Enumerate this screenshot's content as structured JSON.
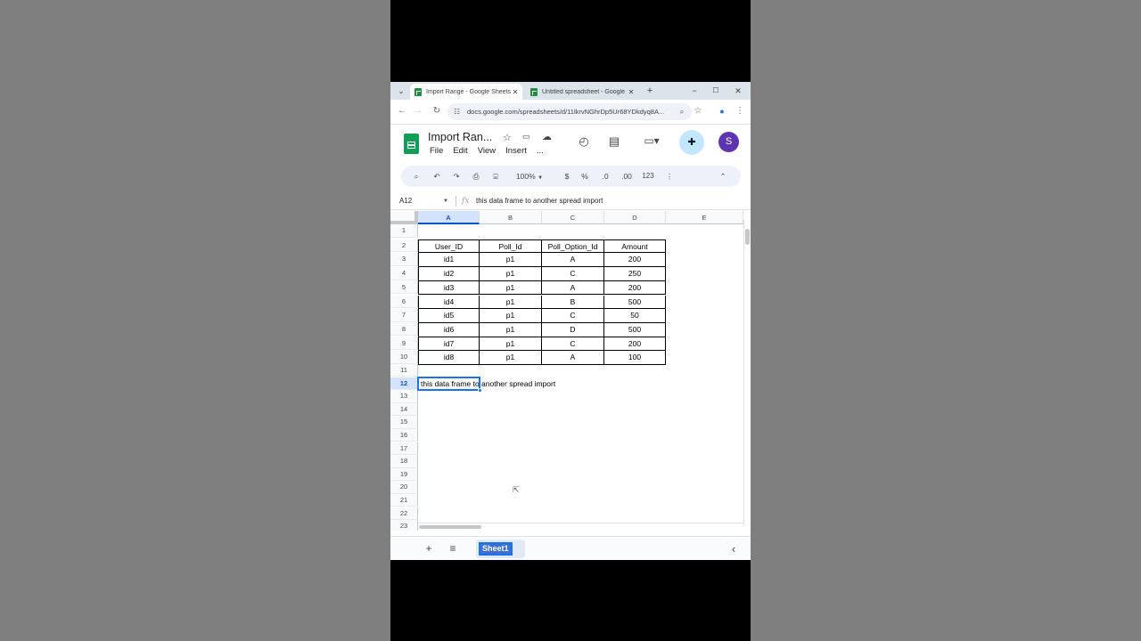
{
  "browser": {
    "tabs": [
      {
        "title": "Import Range - Google Sheets",
        "active": true
      },
      {
        "title": "Untitled spreadsheet - Google",
        "active": false
      }
    ],
    "new_tab": "+",
    "tab_search": "⌄",
    "url": "docs.google.com/spreadsheets/d/11lkrvNGhrDp5Ur68YDkdyq8A...",
    "window_buttons": {
      "minimize": "−",
      "maximize": "☐",
      "close": "✕"
    }
  },
  "doc": {
    "title": "Import Ran...",
    "menu": [
      "File",
      "Edit",
      "View",
      "Insert",
      "..."
    ],
    "avatar_letter": "S"
  },
  "toolbar": {
    "zoom": "100%",
    "currency": "$",
    "percent": "%",
    "decrease_decimal": ".0",
    "increase_decimal": ".00",
    "number_format": "123"
  },
  "formula_bar": {
    "name_box": "A12",
    "fx": "fx",
    "content": "this data frame to another spread import"
  },
  "grid": {
    "columns": [
      "A",
      "B",
      "C",
      "D",
      "E"
    ],
    "selected_column": "A",
    "rows": [
      "1",
      "2",
      "3",
      "4",
      "5",
      "6",
      "7",
      "8",
      "9",
      "10",
      "11",
      "12",
      "13",
      "14",
      "15",
      "16",
      "17",
      "18",
      "19",
      "20",
      "21",
      "22",
      "23"
    ],
    "selected_row": "12",
    "table": {
      "headers": [
        "User_ID",
        "Poll_Id",
        "Poll_Option_Id",
        "Amount"
      ],
      "rows": [
        [
          "id1",
          "p1",
          "A",
          "200"
        ],
        [
          "id2",
          "p1",
          "C",
          "250"
        ],
        [
          "id3",
          "p1",
          "A",
          "200"
        ],
        [
          "id4",
          "p1",
          "B",
          "500"
        ],
        [
          "id5",
          "p1",
          "C",
          "50"
        ],
        [
          "id6",
          "p1",
          "D",
          "500"
        ],
        [
          "id7",
          "p1",
          "C",
          "200"
        ],
        [
          "id8",
          "p1",
          "A",
          "100"
        ]
      ]
    },
    "a12_text": "this data frame to another spread import"
  },
  "bottom_bar": {
    "add_sheet": "+",
    "all_sheets": "≡",
    "sheet_name": "Sheet1",
    "collapse": "‹"
  },
  "colors": {
    "sheets_green": "#0f9d58",
    "selection_blue": "#1a73e8",
    "avatar_purple": "#5e35b1"
  }
}
